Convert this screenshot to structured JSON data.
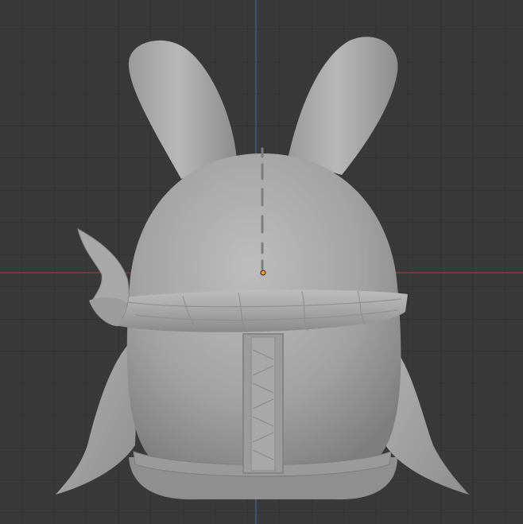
{
  "viewport": {
    "background_color": "#393939",
    "grid_color": "#2f2f2f",
    "x_axis_color": "#b33b42",
    "y_axis_color": "#3a6db5",
    "origin_color": "#ff9a1f"
  },
  "model": {
    "subject": "bunny-figure",
    "base_color": "#a4a4a4",
    "view": "back"
  }
}
